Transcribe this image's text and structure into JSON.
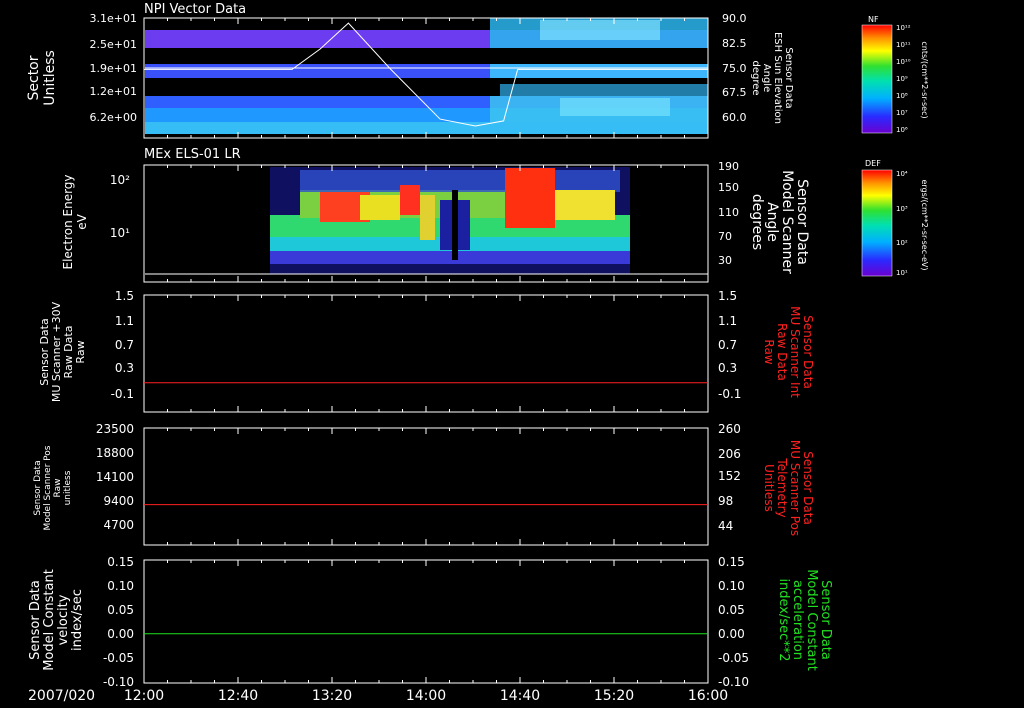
{
  "date_label": "2007/020",
  "time_ticks": [
    "12:00",
    "12:40",
    "13:20",
    "14:00",
    "14:40",
    "15:20",
    "16:00"
  ],
  "colors": {
    "background": "#000000",
    "axis": "#ffffff",
    "red_trace": "#ff2020",
    "green_trace": "#20e020",
    "right_label_red": "#ff2020",
    "right_label_green": "#20e020"
  },
  "chart_data": [
    {
      "type": "heatmap",
      "title": "NPI Vector Data",
      "ylabel_lines": [
        "Sector",
        "Unitless"
      ],
      "yticks_left": [
        "3.1e+01",
        "2.5e+01",
        "1.9e+01",
        "1.2e+01",
        "6.2e+00"
      ],
      "yticks_right": [
        "90.0",
        "82.5",
        "75.0",
        "67.5",
        "60.0"
      ],
      "right_label_lines": [
        "Sensor Data",
        "ESH Sun Elevation",
        "Angle",
        "degree"
      ],
      "colorbar": {
        "label": "NF",
        "ticks": [
          "10¹²",
          "10¹¹",
          "10¹⁰",
          "10⁹",
          "10⁸",
          "10⁷",
          "10⁶"
        ],
        "units": "cnts/(cm**2-sr-sec)"
      },
      "overlay_line": {
        "name": "ESH Sun Elevation Angle",
        "x_hours": [
          12.0,
          13.05,
          13.25,
          13.45,
          13.75,
          14.1,
          14.35,
          14.55,
          14.65,
          16.0
        ],
        "y_deg": [
          75.0,
          75.0,
          81.0,
          88.5,
          75.0,
          60.5,
          58.5,
          60.0,
          75.0,
          75.0
        ],
        "ylim": [
          55.0,
          90.0
        ]
      }
    },
    {
      "type": "heatmap",
      "title": "MEx ELS-01 LR",
      "ylabel_lines": [
        "Electron Energy",
        "eV"
      ],
      "yticks_left": [
        "10²",
        "10¹"
      ],
      "yticks_right": [
        "190",
        "150",
        "110",
        "70",
        "30"
      ],
      "right_label_lines": [
        "Sensor Data",
        "Model Scanner",
        "Angle",
        "degrees"
      ],
      "colorbar": {
        "label": "DEF",
        "ticks": [
          "10⁴",
          "10³",
          "10²",
          "10¹"
        ],
        "units": "ergs/(cm**2-sr-sec-eV)"
      },
      "overlay_line": {
        "name": "Model Scanner Angle",
        "x_hours": [
          12.0,
          16.0
        ],
        "y_deg": [
          3,
          3
        ],
        "ylim": [
          0,
          190
        ]
      }
    },
    {
      "type": "line",
      "ylabel_lines": [
        "Sensor Data",
        "MU Scanner +30V",
        "Raw Data",
        "Raw"
      ],
      "yticks_left": [
        "1.5",
        "1.1",
        "0.7",
        "0.3",
        "-0.1"
      ],
      "yticks_right": [
        "1.5",
        "1.1",
        "0.7",
        "0.3",
        "-0.1"
      ],
      "ylim": [
        -0.5,
        1.5
      ],
      "right_label_lines": [
        "Sensor Data",
        "MU Scanner Int",
        "Raw Data",
        "Raw"
      ],
      "series": [
        {
          "x_hours": [
            12.0,
            16.0
          ],
          "values": [
            0.0,
            0.0
          ]
        }
      ]
    },
    {
      "type": "line",
      "ylabel_lines": [
        "Sensor Data",
        "Model Scanner Pos",
        "Raw",
        "unitless"
      ],
      "yticks_left": [
        "23500",
        "18800",
        "14100",
        "9400",
        "4700"
      ],
      "yticks_right": [
        "260",
        "206",
        "152",
        "98",
        "44"
      ],
      "ylim": [
        0,
        23500
      ],
      "right_label_lines": [
        "Sensor Data",
        "MU Scanner Pos",
        "Telemetry",
        "Unitless"
      ],
      "series": [
        {
          "x_hours": [
            12.0,
            16.0
          ],
          "values": [
            8100,
            8100
          ]
        }
      ]
    },
    {
      "type": "line",
      "ylabel_lines": [
        "Sensor Data",
        "Model Constant",
        "velocity",
        "index/sec"
      ],
      "yticks_left": [
        "0.15",
        "0.10",
        "0.05",
        "0.00",
        "-0.05",
        "-0.10"
      ],
      "yticks_right": [
        "0.15",
        "0.10",
        "0.05",
        "0.00",
        "-0.05",
        "-0.10"
      ],
      "ylim": [
        -0.1,
        0.15
      ],
      "right_label_lines": [
        "Sensor Data",
        "Model Constant",
        "acceleration",
        "index/sec**2"
      ],
      "series": [
        {
          "x_hours": [
            12.0,
            16.0
          ],
          "values": [
            0.0,
            0.0
          ]
        }
      ]
    }
  ]
}
